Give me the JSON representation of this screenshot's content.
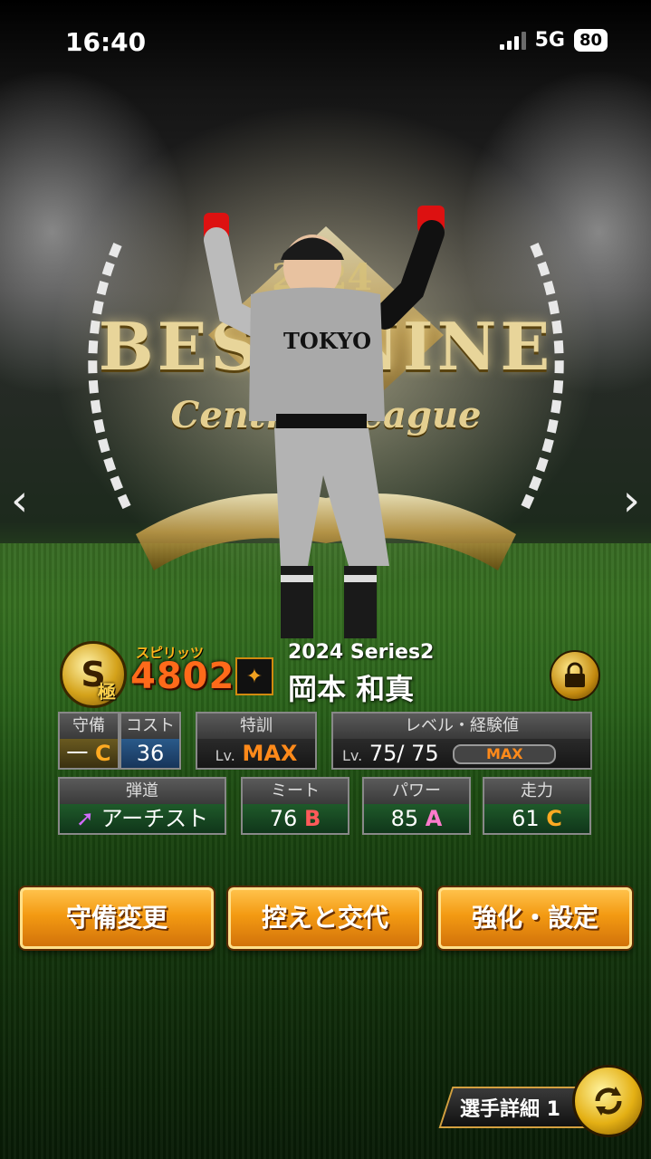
{
  "status_bar": {
    "time": "16:40",
    "network": "5G",
    "battery": "80"
  },
  "emblem": {
    "title": "BEST NINE",
    "subtitle": "Central League",
    "year": "2024"
  },
  "card": {
    "rank": "S",
    "rank_sub": "極",
    "spirits_label": "スピリッツ",
    "spirits_value": "4802",
    "series": "2024 Series2",
    "name": "岡本 和真"
  },
  "stats": {
    "defense": {
      "label": "守備",
      "value": "一",
      "grade": "C"
    },
    "cost": {
      "label": "コスト",
      "value": "36"
    },
    "training": {
      "label": "特訓",
      "prefix": "Lv.",
      "value": "MAX"
    },
    "level": {
      "label": "レベル・経験値",
      "prefix": "Lv.",
      "value": "75/ 75",
      "bar_label": "MAX"
    },
    "trajectory": {
      "label": "弾道",
      "value": "アーチスト"
    },
    "contact": {
      "label": "ミート",
      "value": "76",
      "grade": "B"
    },
    "power": {
      "label": "パワー",
      "value": "85",
      "grade": "A"
    },
    "speed": {
      "label": "走力",
      "value": "61",
      "grade": "C"
    }
  },
  "actions": {
    "change_position": "守備変更",
    "substitute": "控えと交代",
    "enhance_settings": "強化・設定"
  },
  "detail": {
    "label": "選手詳細 1"
  },
  "icons": [
    "chevron-left-icon",
    "chevron-right-icon",
    "lock-icon",
    "refresh-icon",
    "team-logo-icon",
    "trajectory-arrow-icon"
  ],
  "colors": {
    "accent": "#f39a12",
    "spirits": "#ff6a1a",
    "grade_c": "#ffaa22",
    "grade_b": "#ff5a5a",
    "grade_a": "#ff7acc"
  }
}
